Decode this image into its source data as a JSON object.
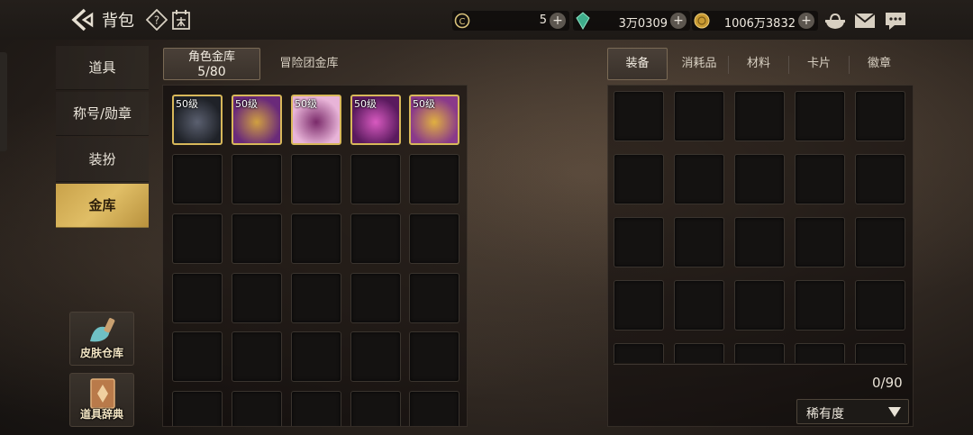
{
  "header": {
    "title": "背包"
  },
  "currencies": [
    {
      "name": "coupon",
      "value": "5"
    },
    {
      "name": "gem",
      "value": "3万0309"
    },
    {
      "name": "gold",
      "value": "1006万3832"
    }
  ],
  "nav": {
    "items": [
      "道具",
      "称号/勋章",
      "装扮",
      "金库"
    ],
    "active_index": 3
  },
  "side_tools": {
    "skin_storage": "皮肤仓库",
    "item_dictionary": "道具辞典"
  },
  "left_tabs": {
    "character_vault_label": "角色金库",
    "character_vault_count": "5/80",
    "adventure_vault_label": "冒险团金库"
  },
  "vault_items": [
    {
      "level": "50级",
      "name": "dark-armor-icon",
      "colors": [
        "#1f2228",
        "#5b6070"
      ]
    },
    {
      "level": "50级",
      "name": "purple-blade-icon",
      "colors": [
        "#6a2a7a",
        "#d0a040"
      ]
    },
    {
      "level": "50级",
      "name": "pink-cloud-icon",
      "colors": [
        "#e8b4d8",
        "#7a2a6a"
      ]
    },
    {
      "level": "50级",
      "name": "purple-boot-icon",
      "colors": [
        "#5a1a5e",
        "#d85ac0"
      ]
    },
    {
      "level": "50级",
      "name": "dragon-mask-icon",
      "colors": [
        "#8a3a8a",
        "#e0b040"
      ]
    }
  ],
  "right_tabs": [
    "装备",
    "消耗品",
    "材料",
    "卡片",
    "徽章"
  ],
  "right_active_index": 0,
  "capacity": "0/90",
  "sort_dropdown": "稀有度",
  "colors": {
    "accent_gold": "#d8b85a",
    "active_nav": "#e0be66"
  }
}
